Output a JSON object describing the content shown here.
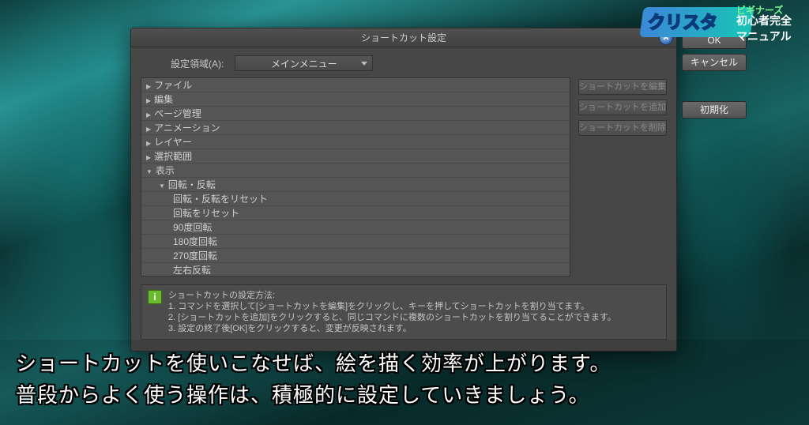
{
  "logo": {
    "brand": "クリスタ",
    "tag1": "ビギナーズ",
    "tag2": "初心者完全",
    "tag3": "マニュアル"
  },
  "dialog": {
    "title": "ショートカット設定",
    "close_glyph": "✕",
    "area_label": "設定領域(A):",
    "dropdown_value": "メインメニュー",
    "buttons": {
      "edit": "ショートカットを編集",
      "add": "ショートカットを追加",
      "delete": "ショートカットを削除",
      "ok": "OK",
      "cancel": "キャンセル",
      "reset": "初期化"
    },
    "tree": {
      "file": "ファイル",
      "edit": "編集",
      "page": "ページ管理",
      "anim": "アニメーション",
      "layer": "レイヤー",
      "select": "選択範囲",
      "view": "表示",
      "rotate": "回転・反転",
      "rotate_reset": "回転・反転をリセット",
      "rot_reset2": "回転をリセット",
      "rot90": "90度回転",
      "rot180": "180度回転",
      "rot270": "270度回転",
      "fliph": "左右反転"
    },
    "info": {
      "heading": "ショートカットの設定方法:",
      "l1": "1. コマンドを選択して[ショートカットを編集]をクリックし、キーを押してショートカットを割り当てます。",
      "l2": "2. [ショートカットを追加]をクリックすると、同じコマンドに複数のショートカットを割り当てることができます。",
      "l3": "3. 設定の終了後[OK]をクリックすると、変更が反映されます。"
    }
  },
  "subtitle": {
    "line1": "ショートカットを使いこなせば、絵を描く効率が上がります。",
    "line2": "普段からよく使う操作は、積極的に設定していきましょう。"
  }
}
